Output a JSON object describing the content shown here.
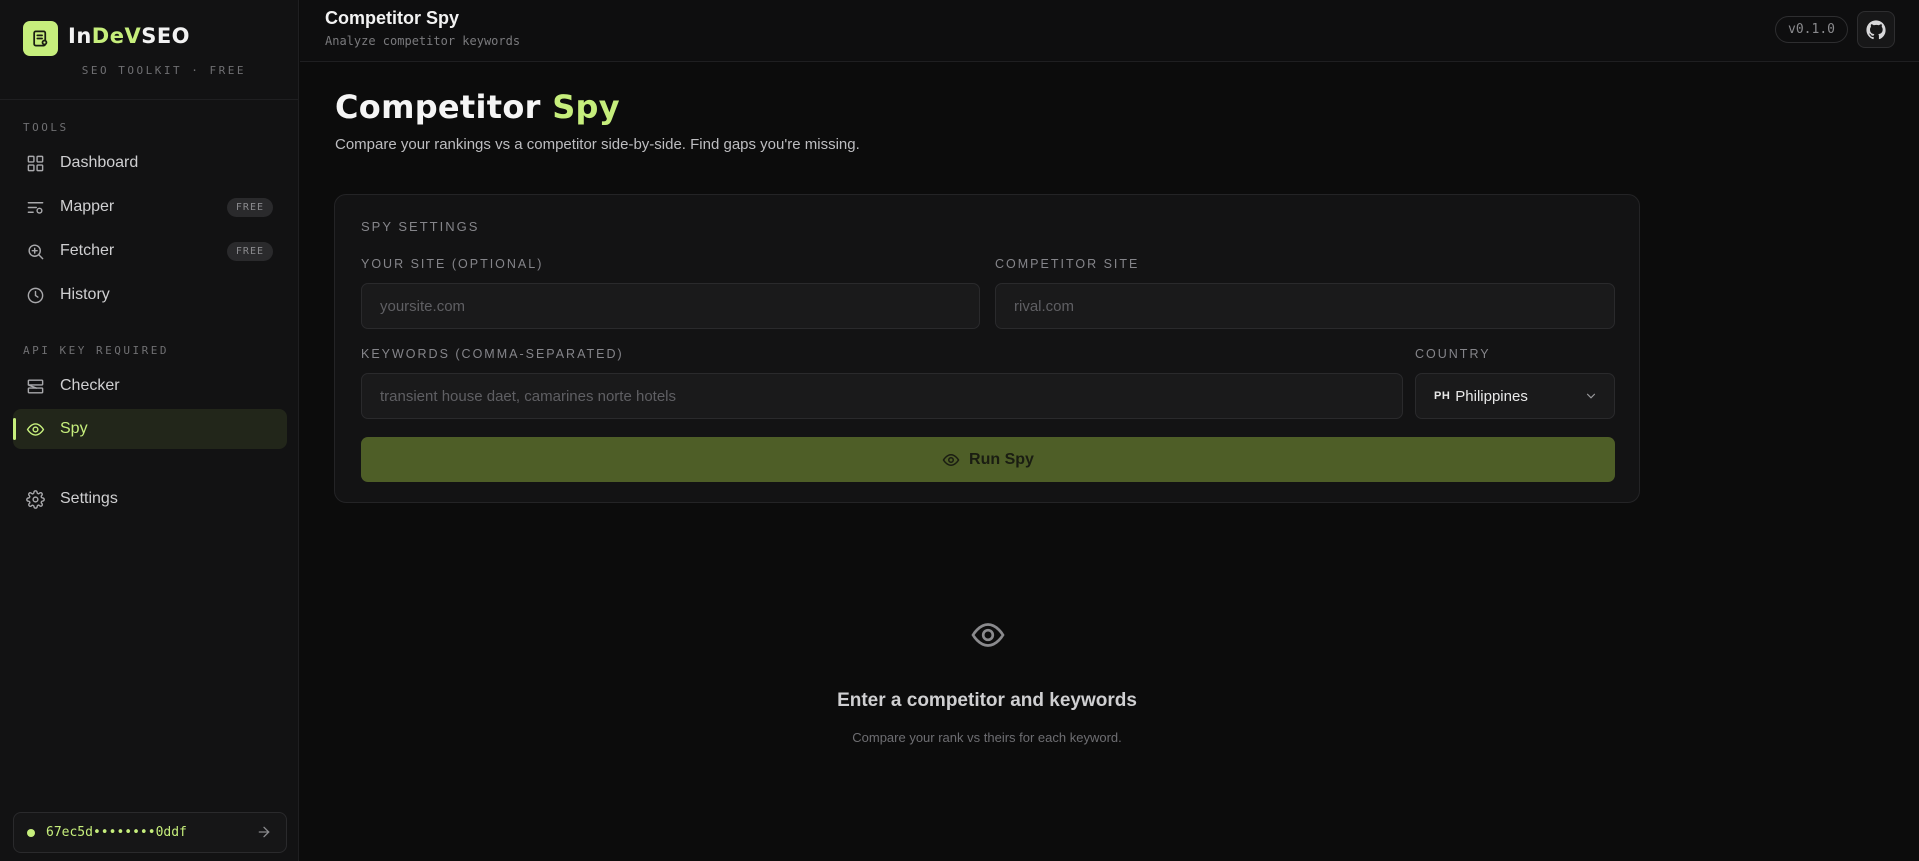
{
  "sidebar": {
    "brand": {
      "part1": "In",
      "part2": "DeV",
      "part3": "SEO",
      "subtitle": "SEO TOOLKIT · FREE"
    },
    "sections": [
      {
        "label": "TOOLS"
      },
      {
        "label": "API KEY REQUIRED"
      }
    ],
    "items": [
      {
        "label": "Dashboard",
        "icon": "grid-icon"
      },
      {
        "label": "Mapper",
        "icon": "list-filter-icon",
        "badge": "FREE"
      },
      {
        "label": "Fetcher",
        "icon": "zoom-in-icon",
        "badge": "FREE"
      },
      {
        "label": "History",
        "icon": "clock-icon"
      },
      {
        "label": "Checker",
        "icon": "server-icon"
      },
      {
        "label": "Spy",
        "icon": "eye-icon",
        "active": true
      },
      {
        "label": "Settings",
        "icon": "gear-icon"
      }
    ],
    "api_key": {
      "value": "67ec5d••••••••0ddf"
    }
  },
  "topbar": {
    "title": "Competitor Spy",
    "subtitle": "Analyze competitor keywords",
    "version": "v0.1.0"
  },
  "main": {
    "title_part1": "Competitor",
    "title_part2": "Spy",
    "description": "Compare your rankings vs a competitor side-by-side. Find gaps you're missing.",
    "form": {
      "section_label": "SPY SETTINGS",
      "your_site_label": "YOUR SITE (OPTIONAL)",
      "your_site_placeholder": "yoursite.com",
      "competitor_label": "COMPETITOR SITE",
      "competitor_placeholder": "rival.com",
      "keywords_label": "KEYWORDS (COMMA-SEPARATED)",
      "keywords_placeholder": "transient house daet, camarines norte hotels",
      "country_label": "COUNTRY",
      "country_flag": "PH",
      "country_value": "Philippines",
      "run_label": "Run Spy"
    },
    "empty_state": {
      "title": "Enter a competitor and keywords",
      "subtitle": "Compare your rank vs theirs for each keyword."
    }
  },
  "colors": {
    "accent": "#c6ee7c",
    "button": "#4e5e27",
    "background": "#0c0c0c"
  }
}
